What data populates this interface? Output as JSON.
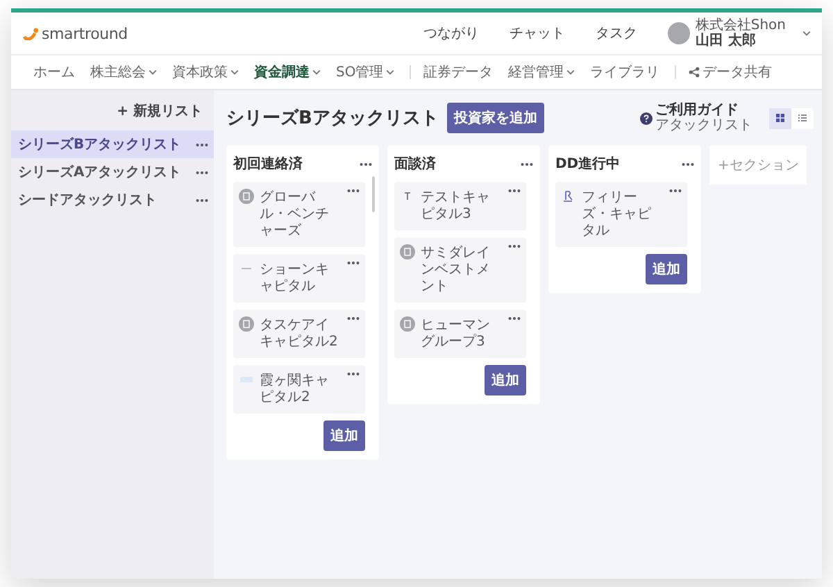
{
  "header": {
    "brand": "smartround",
    "links": [
      "つながり",
      "チャット",
      "タスク"
    ],
    "company": "株式会社Shon",
    "user": "山田 太郎"
  },
  "nav": [
    {
      "label": "ホーム",
      "dropdown": false,
      "selected": false,
      "kind": "link",
      "divider_before": false
    },
    {
      "label": "株主総会",
      "dropdown": true,
      "selected": false,
      "kind": "link",
      "divider_before": false
    },
    {
      "label": "資本政策",
      "dropdown": true,
      "selected": false,
      "kind": "link",
      "divider_before": false
    },
    {
      "label": "資金調達",
      "dropdown": true,
      "selected": true,
      "kind": "link",
      "divider_before": false
    },
    {
      "label": "SO管理",
      "dropdown": true,
      "selected": false,
      "kind": "link",
      "divider_before": false
    },
    {
      "label": "証券データ",
      "dropdown": false,
      "selected": false,
      "kind": "link",
      "divider_before": true
    },
    {
      "label": "経営管理",
      "dropdown": true,
      "selected": false,
      "kind": "link",
      "divider_before": false
    },
    {
      "label": "ライブラリ",
      "dropdown": false,
      "selected": false,
      "kind": "link",
      "divider_before": false
    },
    {
      "label": "データ共有",
      "dropdown": false,
      "selected": false,
      "kind": "share",
      "divider_before": true
    }
  ],
  "sidebar": {
    "new_list": "+ 新規リスト",
    "items": [
      {
        "label": "シリーズBアタックリスト",
        "selected": true
      },
      {
        "label": "シリーズAアタックリスト",
        "selected": false
      },
      {
        "label": "シードアタックリスト",
        "selected": false
      }
    ]
  },
  "board": {
    "title": "シリーズBアタックリスト",
    "add_button": "投資家を追加",
    "guide": {
      "title": "ご利用ガイド",
      "subtitle": "アタックリスト"
    },
    "views": [
      {
        "kind": "grid",
        "selected": true
      },
      {
        "kind": "list",
        "selected": false
      }
    ],
    "columns": [
      {
        "title": "初回連絡済",
        "add": "追加",
        "scrollbar": true,
        "cards": [
          {
            "name": "グローバル・ベンチャーズ",
            "kind": "building"
          },
          {
            "name": "ショーンキャピタル",
            "kind": "line"
          },
          {
            "name": "タスケアイキャピタル2",
            "kind": "building"
          },
          {
            "name": "霞ヶ関キャピタル2",
            "kind": "badge"
          }
        ]
      },
      {
        "title": "面談済",
        "add": "追加",
        "scrollbar": false,
        "cards": [
          {
            "name": "テストキャピタル3",
            "kind": "letter"
          },
          {
            "name": "サミダレインベストメント",
            "kind": "building"
          },
          {
            "name": "ヒューマングループ3",
            "kind": "building"
          }
        ]
      },
      {
        "title": "DD進行中",
        "add": "追加",
        "scrollbar": false,
        "cards": [
          {
            "name": "フィリーズ・キャピタル",
            "kind": "glyph"
          }
        ]
      }
    ],
    "add_section": "+セクション"
  }
}
